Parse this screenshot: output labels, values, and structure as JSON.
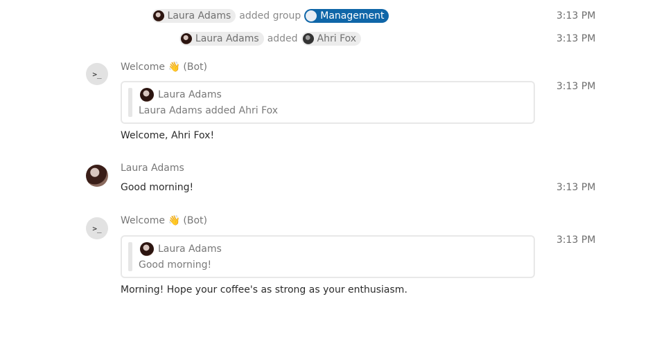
{
  "system_messages": [
    {
      "actor": "Laura Adams",
      "action": "added group",
      "target": "Management",
      "time": "3:13 PM"
    },
    {
      "actor": "Laura Adams",
      "action": "added",
      "target": "Ahri Fox",
      "time": "3:13 PM"
    }
  ],
  "messages": [
    {
      "sender": "Welcome 👋 (Bot)",
      "avatar_text": ">_",
      "quote": {
        "author": "Laura Adams",
        "text": "Laura Adams added Ahri Fox"
      },
      "text": "Welcome, Ahri Fox!",
      "time": "3:13 PM"
    },
    {
      "sender": "Laura Adams",
      "text": "Good morning!",
      "time": "3:13 PM"
    },
    {
      "sender": "Welcome 👋 (Bot)",
      "avatar_text": ">_",
      "quote": {
        "author": "Laura Adams",
        "text": "Good morning!"
      },
      "text": "Morning! Hope your coffee's as strong as your enthusiasm.",
      "time": "3:13 PM"
    }
  ],
  "colors": {
    "group_chip": "#0f66a8",
    "chip": "#ececec",
    "bot_avatar": "#e2e2e2"
  }
}
